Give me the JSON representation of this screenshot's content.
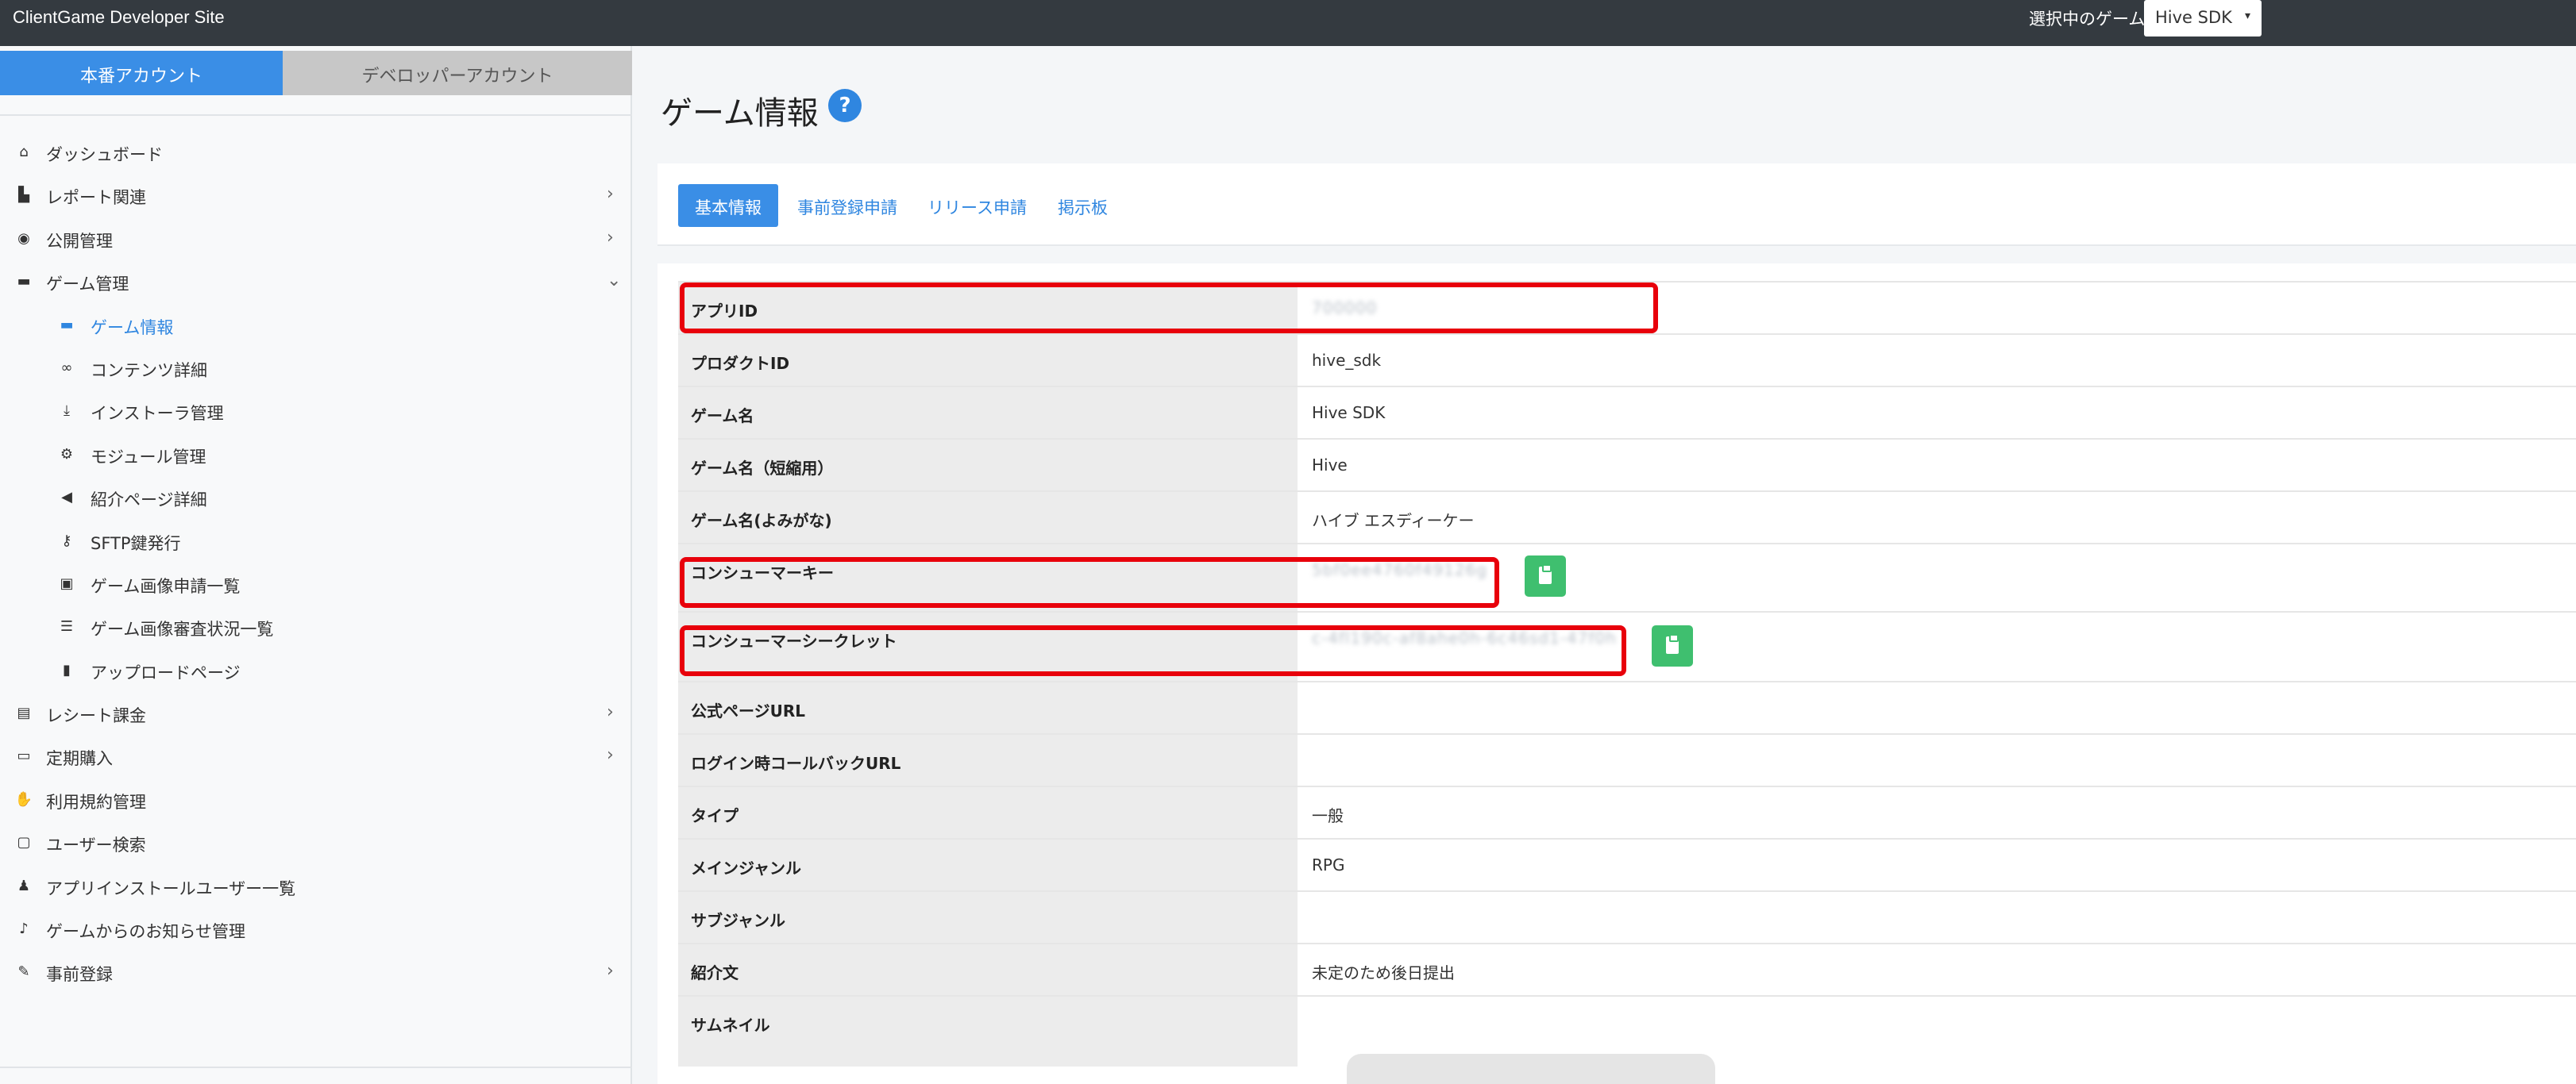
{
  "topbar": {
    "brand": "ClientGame Developer Site",
    "game_select_label": "選択中のゲーム",
    "game_select_value": "Hive SDK",
    "caret": "▾"
  },
  "sidebar": {
    "account_tabs": [
      "本番アカウント",
      "デベロッパーアカウント"
    ],
    "items": [
      {
        "label": "ダッシュボード",
        "icon": "home-icon",
        "glyph": "⌂",
        "chevron": ""
      },
      {
        "label": "レポート関連",
        "icon": "chart-icon",
        "glyph": "▙",
        "chevron": "›"
      },
      {
        "label": "公開管理",
        "icon": "eye-icon",
        "glyph": "◉",
        "chevron": "›"
      },
      {
        "label": "ゲーム管理",
        "icon": "gamepad-icon",
        "glyph": "▬",
        "chevron": "⌄"
      },
      {
        "label": "ゲーム情報",
        "icon": "gamepad-icon",
        "glyph": "▬",
        "chevron": "",
        "sub": true,
        "active": true
      },
      {
        "label": "コンテンツ詳細",
        "icon": "link-icon",
        "glyph": "∞",
        "chevron": "",
        "sub": true
      },
      {
        "label": "インストーラ管理",
        "icon": "download-icon",
        "glyph": "⤓",
        "chevron": "",
        "sub": true
      },
      {
        "label": "モジュール管理",
        "icon": "cogs-icon",
        "glyph": "⚙",
        "chevron": "",
        "sub": true
      },
      {
        "label": "紹介ページ詳細",
        "icon": "megaphone-icon",
        "glyph": "◀",
        "chevron": "",
        "sub": true
      },
      {
        "label": "SFTP鍵発行",
        "icon": "key-icon",
        "glyph": "⚷",
        "chevron": "",
        "sub": true
      },
      {
        "label": "ゲーム画像申請一覧",
        "icon": "image-icon",
        "glyph": "▣",
        "chevron": "",
        "sub": true
      },
      {
        "label": "ゲーム画像審査状況一覧",
        "icon": "list-icon",
        "glyph": "☰",
        "chevron": "",
        "sub": true
      },
      {
        "label": "アップロードページ",
        "icon": "file-icon",
        "glyph": "▮",
        "chevron": "",
        "sub": true
      },
      {
        "label": "レシート課金",
        "icon": "receipt-icon",
        "glyph": "▤",
        "chevron": "›"
      },
      {
        "label": "定期購入",
        "icon": "credit-card-icon",
        "glyph": "▭",
        "chevron": "›"
      },
      {
        "label": "利用規約管理",
        "icon": "handshake-icon",
        "glyph": "✋",
        "chevron": ""
      },
      {
        "label": "ユーザー検索",
        "icon": "id-card-icon",
        "glyph": "▢",
        "chevron": ""
      },
      {
        "label": "アプリインストールユーザー一覧",
        "icon": "users-icon",
        "glyph": "♟",
        "chevron": ""
      },
      {
        "label": "ゲームからのお知らせ管理",
        "icon": "bell-icon",
        "glyph": "♪",
        "chevron": ""
      },
      {
        "label": "事前登録",
        "icon": "edit-icon",
        "glyph": "✎",
        "chevron": "›"
      }
    ]
  },
  "main": {
    "title": "ゲーム情報",
    "help": "?",
    "tabs": [
      "基本情報",
      "事前登録申請",
      "リリース申請",
      "掲示板"
    ],
    "rows": [
      {
        "key": "アプリID",
        "value": "700000",
        "blurred": true
      },
      {
        "key": "プロダクトID",
        "value": "hive_sdk"
      },
      {
        "key": "ゲーム名",
        "value": "Hive SDK"
      },
      {
        "key": "ゲーム名（短縮用）",
        "value": "Hive"
      },
      {
        "key": "ゲーム名(よみがな)",
        "value": "ハイブ エスディーケー"
      },
      {
        "key": "コンシューマーキー",
        "value": "5bf0ee4760f49126g",
        "blurred": true,
        "copy": true
      },
      {
        "key": "コンシューマーシークレット",
        "value": "c-4fl190c-af8ahe0h-6c46sd1-47f0h",
        "blurred": true,
        "copy": true
      },
      {
        "key": "公式ページURL",
        "value": ""
      },
      {
        "key": "ログイン時コールバックURL",
        "value": ""
      },
      {
        "key": "タイプ",
        "value": "一般"
      },
      {
        "key": "メインジャンル",
        "value": "RPG"
      },
      {
        "key": "サブジャンル",
        "value": ""
      },
      {
        "key": "紹介文",
        "value": "未定のため後日提出"
      },
      {
        "key": "サムネイル",
        "value": ""
      }
    ]
  },
  "colors": {
    "accent": "#3a8ee6",
    "topbar": "#343a40",
    "copy_button": "#3fbf6f",
    "highlight": "#e8000b"
  }
}
